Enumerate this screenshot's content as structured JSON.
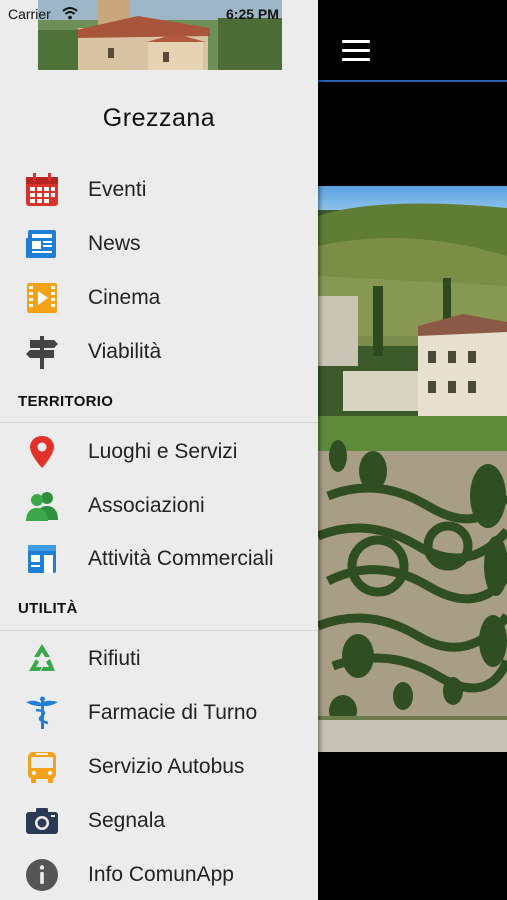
{
  "status_bar": {
    "carrier": "Carrier",
    "time": "6:25 PM"
  },
  "drawer": {
    "town_name": "Grezzana",
    "items": [
      {
        "label": "Eventi",
        "icon": "calendar-icon",
        "color": "#d9342b"
      },
      {
        "label": "News",
        "icon": "newspaper-icon",
        "color": "#1f7fd4"
      },
      {
        "label": "Cinema",
        "icon": "film-icon",
        "color": "#f5a21b"
      },
      {
        "label": "Viabilità",
        "icon": "signpost-icon",
        "color": "#444444"
      }
    ],
    "sections": [
      {
        "title": "TERRITORIO",
        "items": [
          {
            "label": "Luoghi e Servizi",
            "icon": "map-pin-icon",
            "color": "#e0312b"
          },
          {
            "label": "Associazioni",
            "icon": "users-icon",
            "color": "#3aa84a"
          },
          {
            "label": "Attività Commerciali",
            "icon": "shop-icon",
            "color": "#1f7fd4"
          }
        ]
      },
      {
        "title": "UTILITÀ",
        "items": [
          {
            "label": "Rifiuti",
            "icon": "recycle-icon",
            "color": "#3aa84a"
          },
          {
            "label": "Farmacie di Turno",
            "icon": "caduceus-icon",
            "color": "#1f7fd4"
          },
          {
            "label": "Servizio Autobus",
            "icon": "bus-icon",
            "color": "#f5a21b"
          },
          {
            "label": "Segnala",
            "icon": "camera-icon",
            "color": "#2a3a55"
          },
          {
            "label": "Info ComunApp",
            "icon": "info-icon",
            "color": "#555555"
          }
        ]
      }
    ]
  },
  "main": {
    "accent_color": "#2a5fb0"
  }
}
